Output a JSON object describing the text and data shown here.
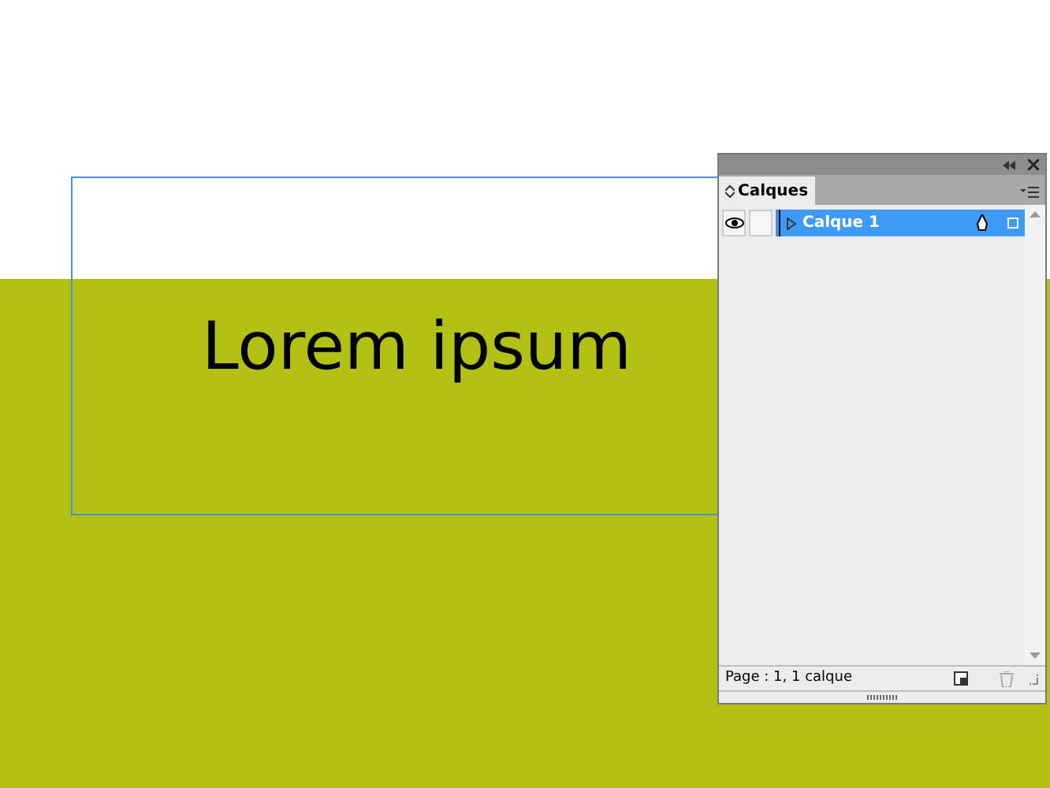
{
  "canvas": {
    "text": "Lorem ipsum"
  },
  "panel": {
    "tab": "Calques",
    "layers": [
      {
        "name": "Calque 1",
        "visible": true,
        "selected": true
      }
    ],
    "status": "Page : 1, 1 calque"
  }
}
